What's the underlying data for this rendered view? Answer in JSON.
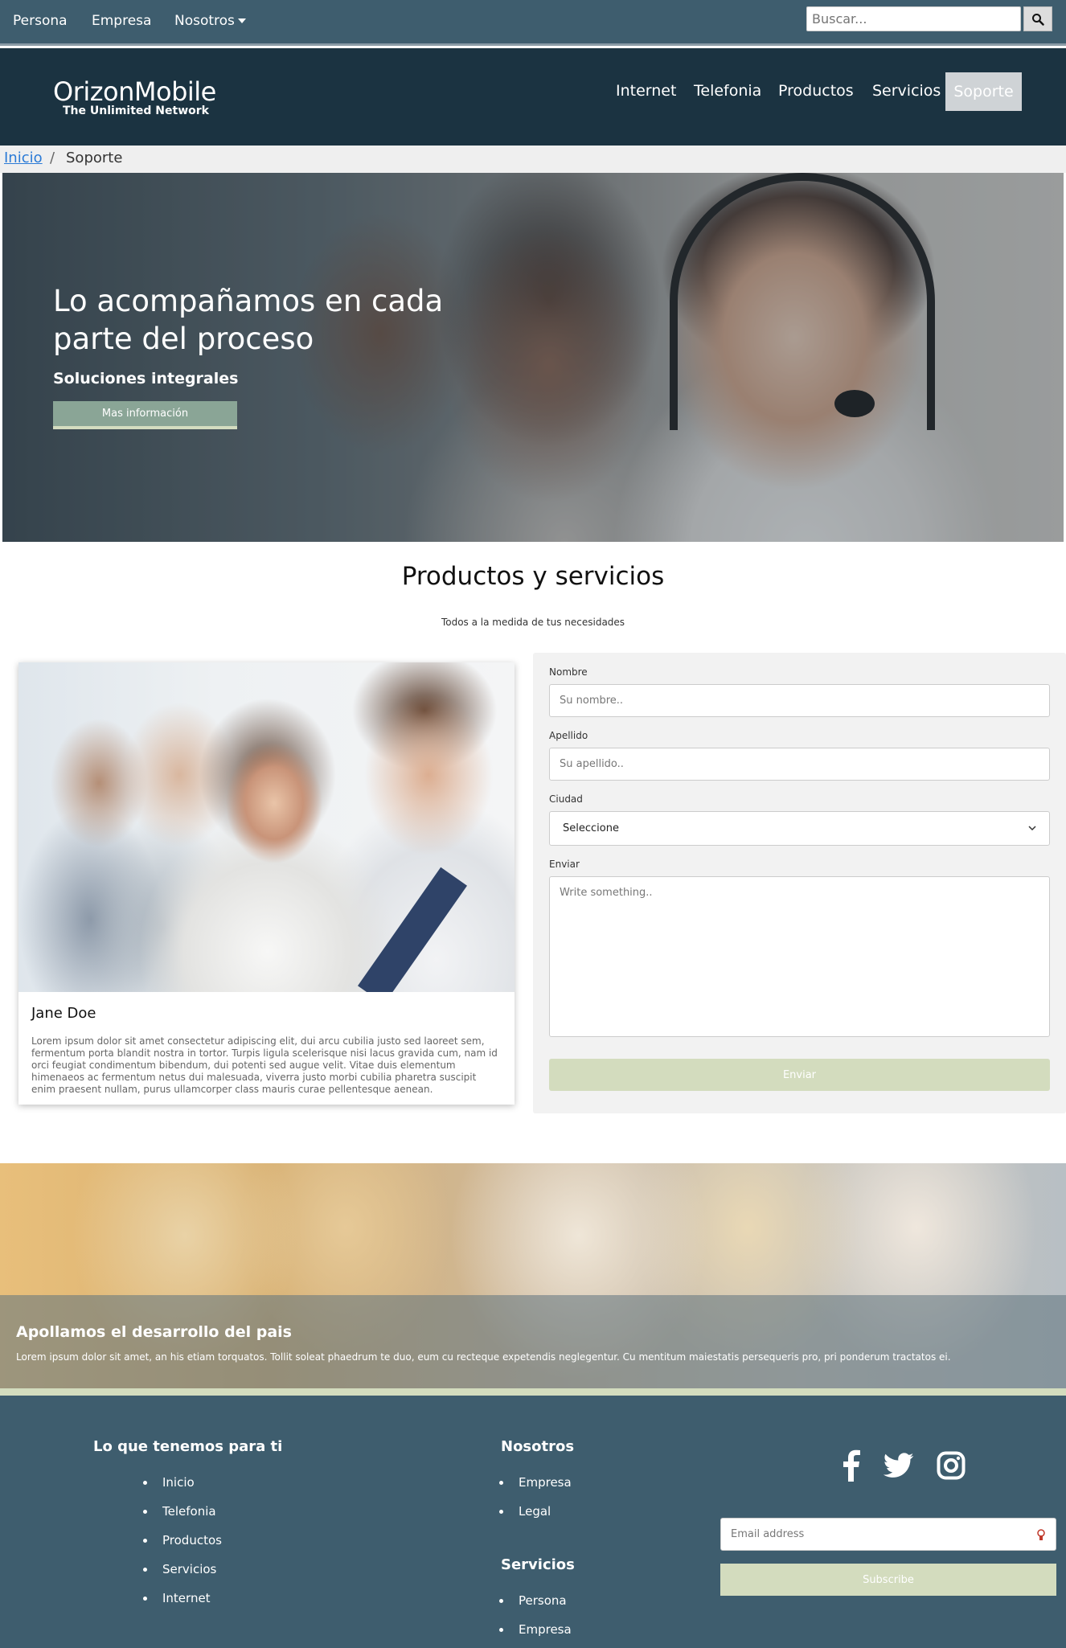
{
  "topbar": {
    "links": [
      "Persona",
      "Empresa",
      "Nosotros"
    ],
    "search_placeholder": "Buscar..."
  },
  "header": {
    "brand": "OrizonMobile",
    "tagline": "The Unlimited Network",
    "nav": [
      "Internet",
      "Telefonia",
      "Productos",
      "Servicios",
      "Soporte"
    ]
  },
  "breadcrumb": {
    "home": "Inicio",
    "separator": "/",
    "current": "Soporte"
  },
  "hero": {
    "title_line1": "Lo acompañamos en cada",
    "title_line2": "parte del proceso",
    "subtitle": "Soluciones integrales",
    "button": "Mas información"
  },
  "products": {
    "title": "Productos y servicios",
    "subtitle": "Todos a la medida de tus necesidades"
  },
  "card": {
    "name": "Jane Doe",
    "text": "Lorem ipsum dolor sit amet consectetur adipiscing elit, dui arcu cubilia justo sed laoreet sem, fermentum porta blandit nostra in tortor. Turpis ligula scelerisque nisi lacus gravida cum, nam id orci feugiat condimentum bibendum, dui potenti sed augue velit. Vitae duis elementum himenaeos ac fermentum netus dui malesuada, viverra justo morbi cubilia pharetra suscipit enim praesent nullam, purus ullamcorper class mauris curae pellentesque aenean."
  },
  "form": {
    "nombre_label": "Nombre",
    "nombre_placeholder": "Su nombre..",
    "apellido_label": "Apellido",
    "apellido_placeholder": "Su apellido..",
    "ciudad_label": "Ciudad",
    "ciudad_value": "Seleccione",
    "enviar_label": "Enviar",
    "message_placeholder": "Write something..",
    "submit": "Enviar"
  },
  "banner": {
    "title": "Apollamos el desarrollo del pais",
    "text": "Lorem ipsum dolor sit amet, an his etiam torquatos. Tollit soleat phaedrum te duo, eum cu recteque expetendis neglegentur. Cu mentitum maiestatis persequeris pro, pri ponderum tractatos ei."
  },
  "footer": {
    "col1_title": "Lo que tenemos para ti",
    "col1_items": [
      "Inicio",
      "Telefonia",
      "Productos",
      "Servicios",
      "Internet"
    ],
    "col2_title": "Nosotros",
    "col2_items": [
      "Empresa",
      "Legal"
    ],
    "col3_title": "Servicios",
    "col3_items": [
      "Persona",
      "Empresa"
    ],
    "email_placeholder": "Email address",
    "subscribe": "Subscribe",
    "social": [
      "facebook-icon",
      "twitter-icon",
      "instagram-icon"
    ]
  },
  "colors": {
    "topbar": "#3e5d6e",
    "header": "#1b3341",
    "accent": "#d3dcbe",
    "hero_button": "#8aa596"
  }
}
